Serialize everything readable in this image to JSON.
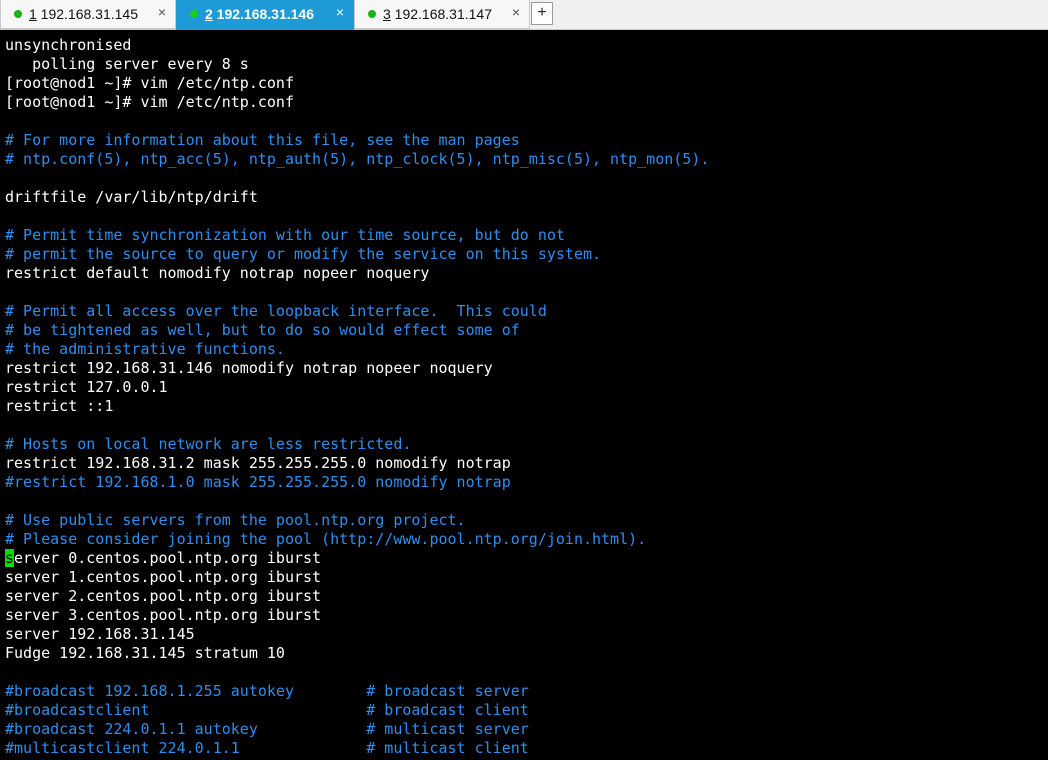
{
  "tabs": [
    {
      "num": "1",
      "label": " 192.168.31.145",
      "active": false
    },
    {
      "num": "2",
      "label": " 192.168.31.146",
      "active": true
    },
    {
      "num": "3",
      "label": " 192.168.31.147",
      "active": false
    }
  ],
  "icons": {
    "close": "×",
    "add": "+"
  },
  "colors": {
    "active_tab": "#1e9bd7",
    "status_dot": "#16b416",
    "comment": "#2e8ef0",
    "cursor": "#00e000"
  },
  "terminal": {
    "lines": [
      {
        "text": "unsynchronised",
        "type": "text"
      },
      {
        "text": "   polling server every 8 s",
        "type": "text"
      },
      {
        "text": "[root@nod1 ~]# vim /etc/ntp.conf",
        "type": "text"
      },
      {
        "text": "[root@nod1 ~]# vim /etc/ntp.conf",
        "type": "text"
      },
      {
        "text": "",
        "type": "text"
      },
      {
        "text": "# For more information about this file, see the man pages",
        "type": "comment"
      },
      {
        "text": "# ntp.conf(5), ntp_acc(5), ntp_auth(5), ntp_clock(5), ntp_misc(5), ntp_mon(5).",
        "type": "comment"
      },
      {
        "text": "",
        "type": "text"
      },
      {
        "text": "driftfile /var/lib/ntp/drift",
        "type": "text"
      },
      {
        "text": "",
        "type": "text"
      },
      {
        "text": "# Permit time synchronization with our time source, but do not",
        "type": "comment"
      },
      {
        "text": "# permit the source to query or modify the service on this system.",
        "type": "comment"
      },
      {
        "text": "restrict default nomodify notrap nopeer noquery",
        "type": "text"
      },
      {
        "text": "",
        "type": "text"
      },
      {
        "text": "# Permit all access over the loopback interface.  This could",
        "type": "comment"
      },
      {
        "text": "# be tightened as well, but to do so would effect some of",
        "type": "comment"
      },
      {
        "text": "# the administrative functions.",
        "type": "comment"
      },
      {
        "text": "restrict 192.168.31.146 nomodify notrap nopeer noquery",
        "type": "text"
      },
      {
        "text": "restrict 127.0.0.1",
        "type": "text"
      },
      {
        "text": "restrict ::1",
        "type": "text"
      },
      {
        "text": "",
        "type": "text"
      },
      {
        "text": "# Hosts on local network are less restricted.",
        "type": "comment"
      },
      {
        "text": "restrict 192.168.31.2 mask 255.255.255.0 nomodify notrap",
        "type": "text"
      },
      {
        "text": "#restrict 192.168.1.0 mask 255.255.255.0 nomodify notrap",
        "type": "comment"
      },
      {
        "text": "",
        "type": "text"
      },
      {
        "text": "# Use public servers from the pool.ntp.org project.",
        "type": "comment"
      },
      {
        "text": "# Please consider joining the pool (http://www.pool.ntp.org/join.html).",
        "type": "comment"
      },
      {
        "text": "server 0.centos.pool.ntp.org iburst",
        "type": "text",
        "cursor": true
      },
      {
        "text": "server 1.centos.pool.ntp.org iburst",
        "type": "text"
      },
      {
        "text": "server 2.centos.pool.ntp.org iburst",
        "type": "text"
      },
      {
        "text": "server 3.centos.pool.ntp.org iburst",
        "type": "text"
      },
      {
        "text": "server 192.168.31.145",
        "type": "text"
      },
      {
        "text": "Fudge 192.168.31.145 stratum 10",
        "type": "text"
      },
      {
        "text": "",
        "type": "text"
      },
      {
        "text": "#broadcast 192.168.1.255 autokey        # broadcast server",
        "type": "comment"
      },
      {
        "text": "#broadcastclient                        # broadcast client",
        "type": "comment"
      },
      {
        "text": "#broadcast 224.0.1.1 autokey            # multicast server",
        "type": "comment"
      },
      {
        "text": "#multicastclient 224.0.1.1              # multicast client",
        "type": "comment"
      }
    ]
  }
}
